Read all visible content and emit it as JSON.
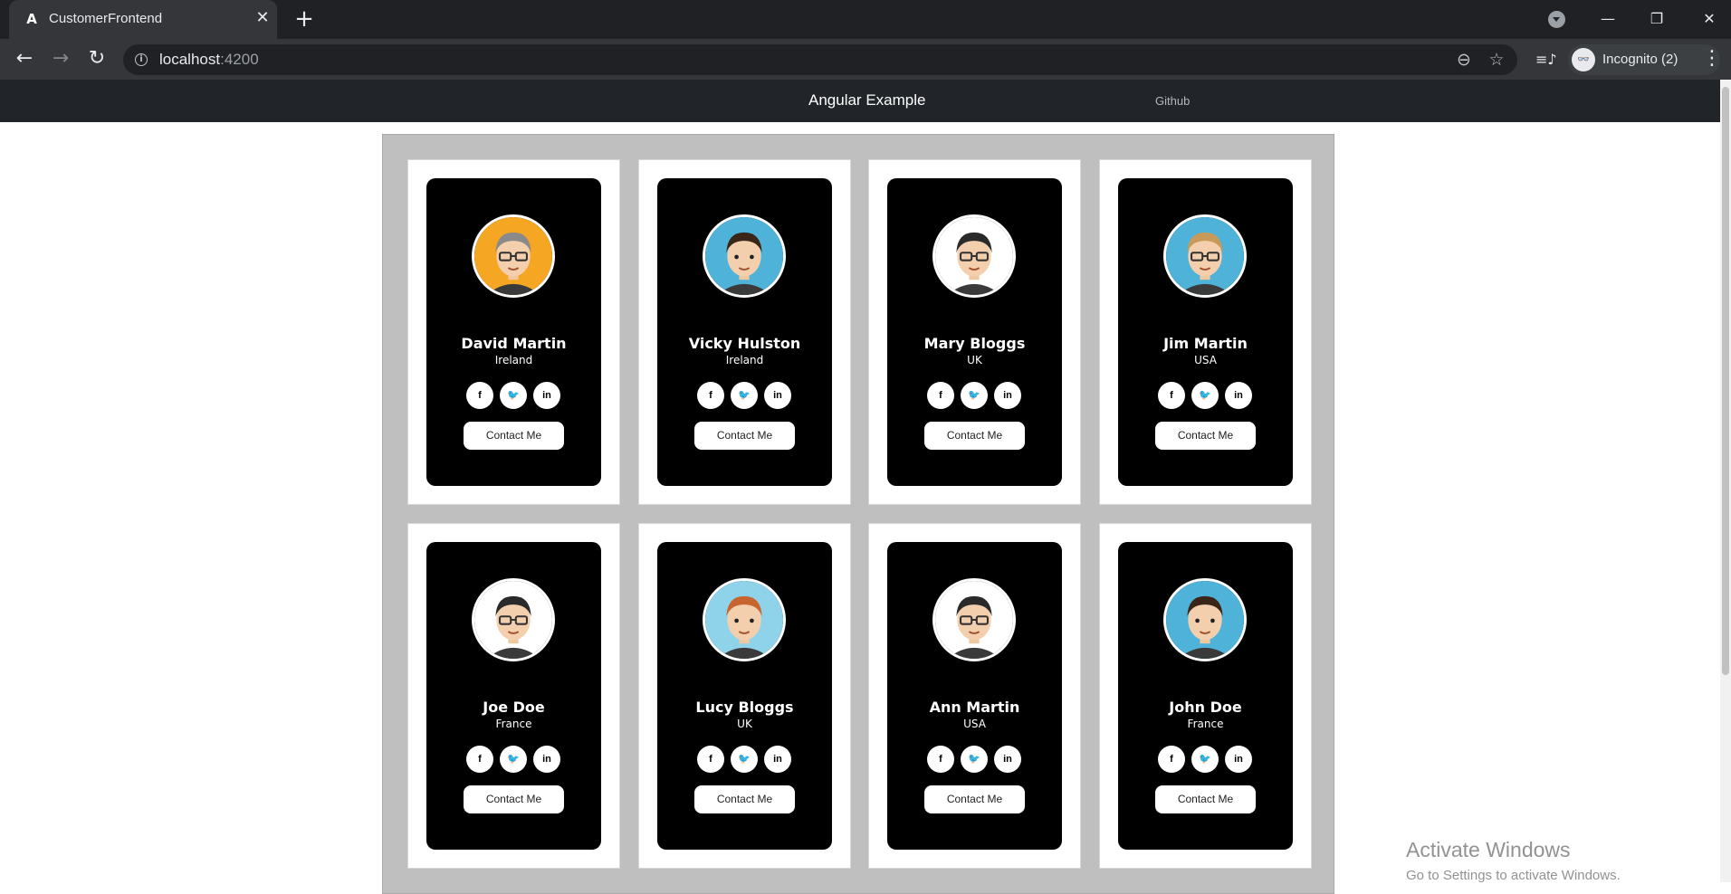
{
  "browser": {
    "tab_title": "CustomerFrontend",
    "url_host": "localhost",
    "url_port": ":4200",
    "profile_label": "Incognito (2)",
    "colors": {
      "chrome_dark": "#202124",
      "chrome_light": "#35363a"
    }
  },
  "app": {
    "brand": "Angular Example",
    "nav_link": "Github",
    "nav_bg": "#212529"
  },
  "customers": [
    {
      "name": "David Martin",
      "country": "Ireland",
      "avatar_bg": "#f5a623",
      "hair": "#8a8a8a",
      "glasses": true
    },
    {
      "name": "Vicky Hulston",
      "country": "Ireland",
      "avatar_bg": "#4fb3d9",
      "hair": "#3b2418",
      "glasses": false
    },
    {
      "name": "Mary Bloggs",
      "country": "UK",
      "avatar_bg": "#ffffff",
      "hair": "#2a2a2a",
      "glasses": true
    },
    {
      "name": "Jim Martin",
      "country": "USA",
      "avatar_bg": "#4fb3d9",
      "hair": "#c89a5a",
      "glasses": true
    },
    {
      "name": "Joe Doe",
      "country": "France",
      "avatar_bg": "#ffffff",
      "hair": "#2a2a2a",
      "glasses": true
    },
    {
      "name": "Lucy Bloggs",
      "country": "UK",
      "avatar_bg": "#8fd3ea",
      "hair": "#c8652f",
      "glasses": false
    },
    {
      "name": "Ann Martin",
      "country": "USA",
      "avatar_bg": "#ffffff",
      "hair": "#2a2a2a",
      "glasses": true
    },
    {
      "name": "John Doe",
      "country": "France",
      "avatar_bg": "#4fb3d9",
      "hair": "#3b2418",
      "glasses": false
    }
  ],
  "card": {
    "contact_label": "Contact Me",
    "social": {
      "facebook": "f",
      "twitter": "🐦",
      "linkedin": "in"
    }
  },
  "watermark": {
    "title": "Activate Windows",
    "subtitle": "Go to Settings to activate Windows."
  }
}
